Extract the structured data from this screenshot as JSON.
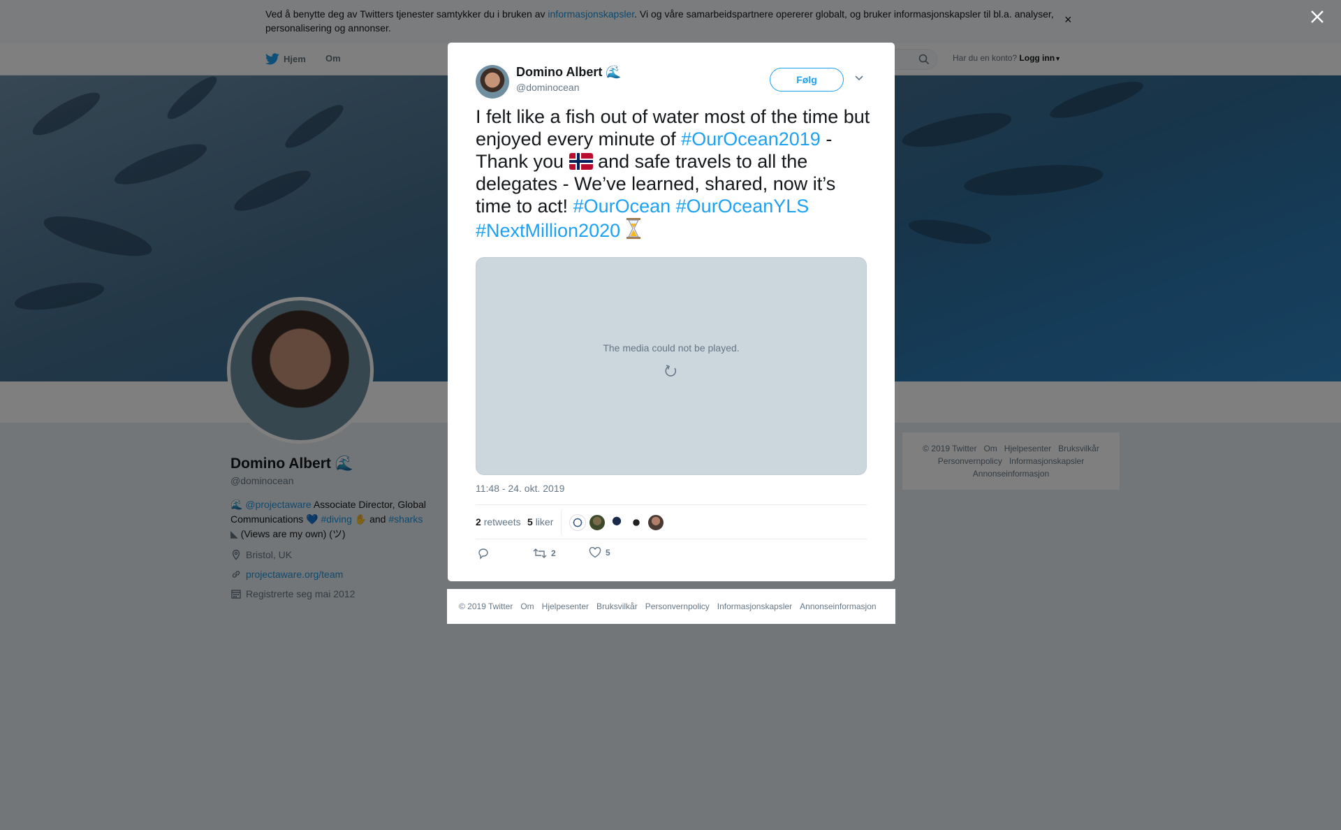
{
  "cookie_banner": {
    "text_before": "Ved å benytte deg av Twitters tjenester samtykker du i bruken av ",
    "link": "informasjonskapsler",
    "text_after": ". Vi og våre samarbeidspartnere opererer globalt, og bruker informasjonskapsler til bl.a. analyser, personalisering og annonser.",
    "close_label": "×"
  },
  "nav": {
    "home": "Hjem",
    "about": "Om",
    "have_account": "Har du en konto?",
    "login": "Logg inn"
  },
  "profile": {
    "name": "Domino Albert",
    "name_emoji": "🌊",
    "handle": "@dominocean",
    "bio_wave": "🌊",
    "bio_mention": "@projectaware",
    "bio_text1": " Associate Director, Global Communications ",
    "bio_heart": "💙",
    "bio_tag1": "#diving",
    "bio_text2": " and ",
    "bio_tag2": "#sharks",
    "bio_text3": "(Views are my own) (ツ)",
    "location": "Bristol, UK",
    "website": "projectaware.org/team",
    "joined": "Registrerte seg mai 2012"
  },
  "side_footer": {
    "items": [
      "© 2019 Twitter",
      "Om",
      "Hjelpesenter",
      "Bruksvilkår",
      "Personvernpolicy",
      "Informasjonskapsler",
      "Annonseinformasjon"
    ]
  },
  "tweet": {
    "author_name": "Domino Albert",
    "author_emoji": "🌊",
    "author_handle": "@dominocean",
    "follow_label": "Følg",
    "text_part1": "I felt like a fish out of water most of the time but enjoyed every minute of ",
    "hashtag1": "#OurOcean2019",
    "text_part2": " - Thank you ",
    "text_part3": " and safe travels to all the delegates - We’ve learned, shared, now it’s time to act! ",
    "hashtag2": "#OurOcean",
    "hashtag3": "#OurOceanYLS",
    "hashtag4": "#NextMillion2020",
    "media_message": "The media could not be played.",
    "timestamp": "11:48 - 24. okt. 2019",
    "retweets_count": "2",
    "retweets_label": "retweets",
    "likes_count": "5",
    "likes_label": "liker",
    "retweet_action_count": "2",
    "like_action_count": "5"
  },
  "modal_footer": {
    "items": [
      "© 2019 Twitter",
      "Om",
      "Hjelpesenter",
      "Bruksvilkår",
      "Personvernpolicy",
      "Informasjonskapsler",
      "Annonseinformasjon"
    ]
  },
  "colors": {
    "accent": "#1da1f2",
    "link": "#1b95e0",
    "secondary_text": "#657786"
  }
}
